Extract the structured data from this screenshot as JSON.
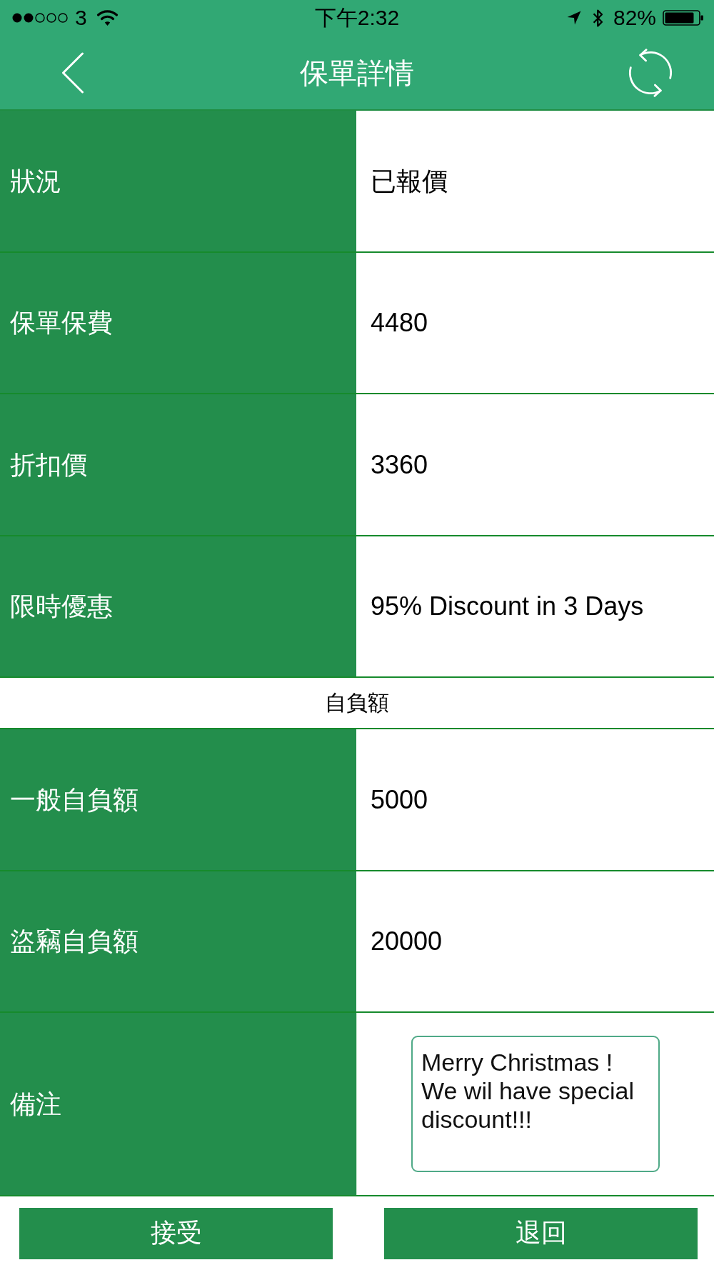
{
  "status_bar": {
    "carrier": "3",
    "time": "下午2:32",
    "battery": "82%"
  },
  "nav_bar": {
    "title": "保單詳情"
  },
  "rows": [
    {
      "kind": "field",
      "label": "狀況",
      "value": "已報價"
    },
    {
      "kind": "field",
      "label": "保單保費",
      "value": "4480"
    },
    {
      "kind": "field",
      "label": "折扣價",
      "value": "3360"
    },
    {
      "kind": "field",
      "label": "限時優惠",
      "value": "95% Discount in 3 Days"
    },
    {
      "kind": "section",
      "title": "自負額"
    },
    {
      "kind": "field",
      "label": "一般自負額",
      "value": "5000"
    },
    {
      "kind": "field",
      "label": "盜竊自負額",
      "value": "20000"
    },
    {
      "kind": "note",
      "label": "備注",
      "value": "Merry Christmas ! We wil have special discount!!!"
    }
  ],
  "buttons": [
    {
      "label": "接受"
    },
    {
      "label": "退回"
    }
  ]
}
